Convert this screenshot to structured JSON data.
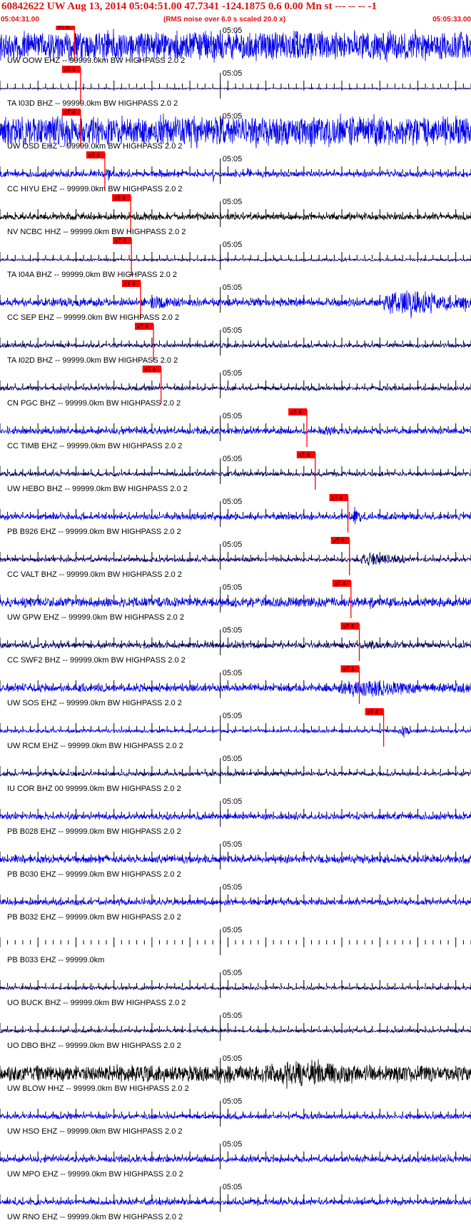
{
  "header": {
    "title": "60842622 UW Aug 13, 2014 05:04:51.00   47.7341 -124.1875  0.6 0.00 Mn st --- -- --  -1",
    "start_time": "05:04:31.00",
    "subtitle": "(RMS noise over 6.0 s scaled 20.0 x)",
    "end_time": "05:05:33.00",
    "title_color": "#dd1111"
  },
  "chart_data": {
    "type": "line",
    "time_range": [
      "05:04:31.00",
      "05:05:33.00"
    ],
    "minute_mark_label": "05:05",
    "minute_mark_time": "05:05:00.00",
    "pick_label": "xT 4",
    "tick_interval_seconds": 1,
    "grid": false,
    "pick_color": "#ff0000",
    "series": [
      {
        "label": "UW OOW EHZ -- 99999.0km BW  HIGHPASS  2.0  2",
        "color": "#0000ee",
        "pick_time": "05:04:40.8",
        "amplitude": 1.0,
        "bursts": [
          [
            10.0,
            13.2,
            1.0
          ],
          [
            17.5,
            23.5,
            1.0
          ]
        ]
      },
      {
        "label": "TA I03D BHZ -- 99999.0km BW  HIGHPASS  2.0  2",
        "color": "#000066",
        "pick_time": "05:04:41.6",
        "amplitude": 0.05,
        "bursts": []
      },
      {
        "label": "UW OSD EHZ -- 99999.0km BW  HIGHPASS  2.0  2",
        "color": "#0000ee",
        "pick_time": "05:04:41.6",
        "amplitude": 1.0,
        "bursts": [
          [
            10.0,
            13.2,
            1.0
          ],
          [
            17.5,
            23.5,
            1.0
          ],
          [
            49.0,
            51.5,
            0.7
          ]
        ]
      },
      {
        "label": "CC HIYU EHZ -- 99999.0km BW  HIGHPASS  2.0  2",
        "color": "#0000ee",
        "pick_time": "05:04:44.8",
        "amplitude": 0.2,
        "bursts": [
          [
            14.0,
            15.0,
            0.5
          ],
          [
            21.0,
            21.5,
            0.4
          ],
          [
            28.0,
            28.3,
            0.6
          ],
          [
            32.5,
            33.0,
            0.5
          ]
        ]
      },
      {
        "label": "NV NCBC HHZ -- 99999.0km BW  HIGHPASS  2.0  2",
        "color": "#000000",
        "pick_time": "05:04:48.2",
        "amplitude": 0.2,
        "bursts": [
          [
            18.5,
            21.0,
            0.35
          ]
        ]
      },
      {
        "label": "TA I04A BHZ -- 99999.0km BW  HIGHPASS  2.0  2",
        "color": "#000066",
        "pick_time": "05:04:48.3",
        "amplitude": 0.08,
        "bursts": [
          [
            36.0,
            37.0,
            0.15
          ],
          [
            44.0,
            48.0,
            0.12
          ]
        ]
      },
      {
        "label": "CC SEP EHZ -- 99999.0km BW  HIGHPASS  2.0  2",
        "color": "#0000ee",
        "pick_time": "05:04:49.5",
        "amplitude": 0.25,
        "bursts": [
          [
            19.5,
            24.0,
            0.5
          ],
          [
            50.5,
            61.8,
            0.95
          ]
        ]
      },
      {
        "label": "TA I02D BHZ -- 99999.0km BW  HIGHPASS  2.0  2",
        "color": "#000066",
        "pick_time": "05:04:51.2",
        "amplitude": 0.15,
        "bursts": []
      },
      {
        "label": "CN PGC BHZ -- 99999.0km BW  HIGHPASS  2.0  2",
        "color": "#000066",
        "pick_time": "05:04:52.2",
        "amplitude": 0.15,
        "bursts": []
      },
      {
        "label": "CC TIMB EHZ -- 99999.0km BW  HIGHPASS  2.0  2",
        "color": "#0000ee",
        "pick_time": "05:05:11.4",
        "amplitude": 0.2,
        "bursts": [
          [
            18.0,
            21.0,
            0.3
          ],
          [
            42.0,
            46.0,
            0.3
          ]
        ]
      },
      {
        "label": "UW HEBO BHZ -- 99999.0km BW  HIGHPASS  2.0  2",
        "color": "#000066",
        "pick_time": "05:05:12.5",
        "amplitude": 0.15,
        "bursts": []
      },
      {
        "label": "PB B926 EHZ -- 99999.0km BW  HIGHPASS  2.0  2",
        "color": "#0000ee",
        "pick_time": "05:05:16.8",
        "amplitude": 0.2,
        "bursts": [
          [
            46.5,
            47.5,
            0.7
          ],
          [
            62.0,
            62.3,
            0.5
          ]
        ]
      },
      {
        "label": "CC VALT BHZ -- 99999.0km BW  HIGHPASS  2.0  2",
        "color": "#000066",
        "pick_time": "05:05:17.0",
        "amplitude": 0.15,
        "bursts": [
          [
            47.5,
            53.5,
            0.55
          ]
        ]
      },
      {
        "label": "UW GPW EHZ -- 99999.0km BW  HIGHPASS  2.0  2",
        "color": "#0000ee",
        "pick_time": "05:05:17.2",
        "amplitude": 0.3,
        "bursts": [
          [
            17.0,
            18.5,
            0.4
          ],
          [
            48.0,
            50.5,
            0.5
          ]
        ]
      },
      {
        "label": "CC SWF2 BHZ -- 99999.0km BW  HIGHPASS  2.0  2",
        "color": "#000066",
        "pick_time": "05:05:18.3",
        "amplitude": 0.2,
        "bursts": [
          [
            48.0,
            52.0,
            0.3
          ]
        ]
      },
      {
        "label": "UW SOS EHZ -- 99999.0km BW  HIGHPASS  2.0  2",
        "color": "#0000ee",
        "pick_time": "05:05:18.3",
        "amplitude": 0.25,
        "bursts": [
          [
            44.0,
            62.0,
            0.6
          ]
        ]
      },
      {
        "label": "UW RCM EHZ -- 99999.0km BW  HIGHPASS  2.0  2",
        "color": "#0000ee",
        "pick_time": "05:05:21.5",
        "amplitude": 0.12,
        "bursts": [
          [
            52.5,
            54.0,
            0.45
          ]
        ]
      },
      {
        "label": "IU COR BHZ 00 99999.0km BW  HIGHPASS  2.0  2",
        "color": "#000066",
        "pick_time": null,
        "amplitude": 0.15,
        "bursts": []
      },
      {
        "label": "PB B028 EHZ -- 99999.0km BW  HIGHPASS  2.0  2",
        "color": "#0000ee",
        "pick_time": null,
        "amplitude": 0.2,
        "bursts": []
      },
      {
        "label": "PB B030 EHZ -- 99999.0km BW  HIGHPASS  2.0  2",
        "color": "#0000ee",
        "pick_time": null,
        "amplitude": 0.25,
        "bursts": []
      },
      {
        "label": "PB B032 EHZ -- 99999.0km BW  HIGHPASS  2.0  2",
        "color": "#0000ee",
        "pick_time": null,
        "amplitude": 0.2,
        "bursts": []
      },
      {
        "label": "PB B033 EHZ -- 99999.0km",
        "color": "#0000ee",
        "pick_time": null,
        "amplitude": 0.0,
        "bursts": []
      },
      {
        "label": "UO BUCK BHZ -- 99999.0km BW  HIGHPASS  2.0  2",
        "color": "#000066",
        "pick_time": null,
        "amplitude": 0.12,
        "bursts": []
      },
      {
        "label": "UO DBO BHZ -- 99999.0km BW  HIGHPASS  2.0  2",
        "color": "#000066",
        "pick_time": null,
        "amplitude": 0.12,
        "bursts": []
      },
      {
        "label": "UW BLOW HHZ -- 99999.0km BW  HIGHPASS  2.0  2",
        "color": "#000000",
        "pick_time": null,
        "amplitude": 0.55,
        "bursts": [
          [
            33.0,
            58.0,
            0.9
          ]
        ]
      },
      {
        "label": "UW HSO EHZ -- 99999.0km BW  HIGHPASS  2.0  2",
        "color": "#0000ee",
        "pick_time": null,
        "amplitude": 0.18,
        "bursts": []
      },
      {
        "label": "UW MPO EHZ -- 99999.0km BW  HIGHPASS  2.0  2",
        "color": "#0000ee",
        "pick_time": null,
        "amplitude": 0.2,
        "bursts": []
      },
      {
        "label": "UW RNO EHZ -- 99999.0km BW  HIGHPASS  2.0  2",
        "color": "#0000ee",
        "pick_time": null,
        "amplitude": 0.2,
        "bursts": []
      }
    ]
  }
}
